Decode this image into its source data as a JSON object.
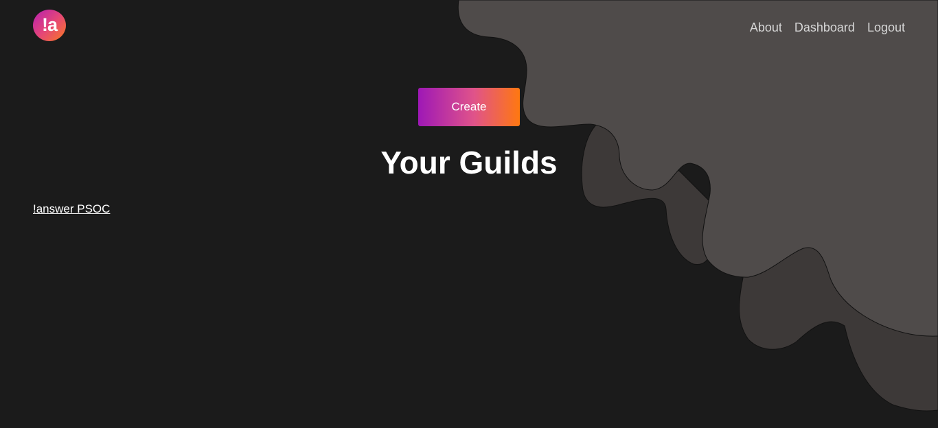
{
  "header": {
    "logo_text": "!a",
    "nav": {
      "about": "About",
      "dashboard": "Dashboard",
      "logout": "Logout"
    }
  },
  "main": {
    "create_label": "Create",
    "title": "Your Guilds",
    "guilds": [
      "!answer PSOC"
    ]
  },
  "colors": {
    "background": "#1b1b1b",
    "blob_light": "#4f4b4a",
    "blob_dark": "#3d3938",
    "gradient_start": "#9e18b6",
    "gradient_end": "#ff7810"
  }
}
